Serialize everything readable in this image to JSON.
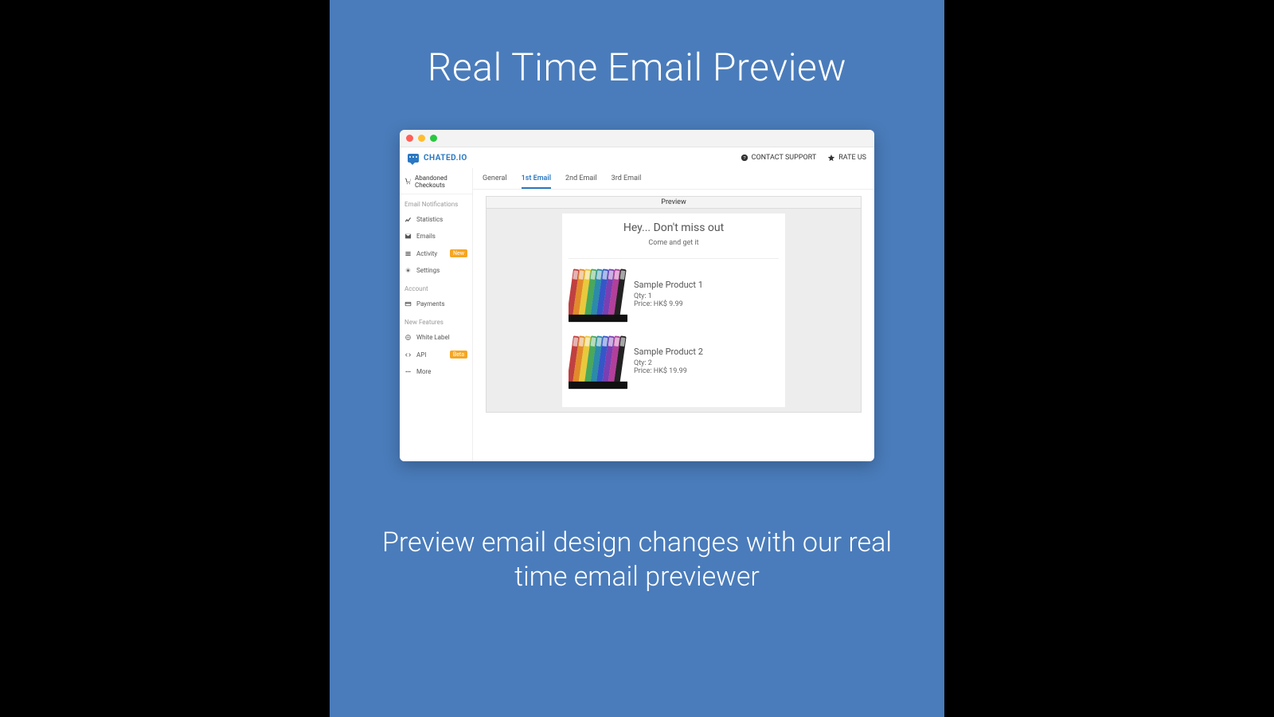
{
  "marketing": {
    "headline": "Real Time Email Preview",
    "subhead": "Preview email design changes with our real time email previewer"
  },
  "brand": {
    "name": "CHATED.IO"
  },
  "topbar": {
    "contact": "CONTACT SUPPORT",
    "rate": "RATE US"
  },
  "sidebar": {
    "top": "Abandoned Checkouts",
    "sections": [
      {
        "title": "Email Notifications",
        "items": [
          {
            "icon": "chart-icon",
            "label": "Statistics",
            "badge": null
          },
          {
            "icon": "mail-icon",
            "label": "Emails",
            "badge": null
          },
          {
            "icon": "list-icon",
            "label": "Activity",
            "badge": "New"
          },
          {
            "icon": "gear-icon",
            "label": "Settings",
            "badge": null
          }
        ]
      },
      {
        "title": "Account",
        "items": [
          {
            "icon": "card-icon",
            "label": "Payments",
            "badge": null
          }
        ]
      },
      {
        "title": "New Features",
        "items": [
          {
            "icon": "globe-icon",
            "label": "White Label",
            "badge": null
          },
          {
            "icon": "code-icon",
            "label": "API",
            "badge": "Beta"
          },
          {
            "icon": "dots-icon",
            "label": "More",
            "badge": null
          }
        ]
      }
    ]
  },
  "tabs": {
    "items": [
      "General",
      "1st Email",
      "2nd Email",
      "3rd Email"
    ],
    "active": "1st Email"
  },
  "preview": {
    "panel_title": "Preview",
    "email": {
      "headline": "Hey... Don't miss out",
      "sub": "Come and get it",
      "products": [
        {
          "name": "Sample Product 1",
          "qty": "Qty: 1",
          "price": "Price: HK$ 9.99"
        },
        {
          "name": "Sample Product 2",
          "qty": "Qty: 2",
          "price": "Price: HK$ 19.99"
        }
      ]
    }
  }
}
